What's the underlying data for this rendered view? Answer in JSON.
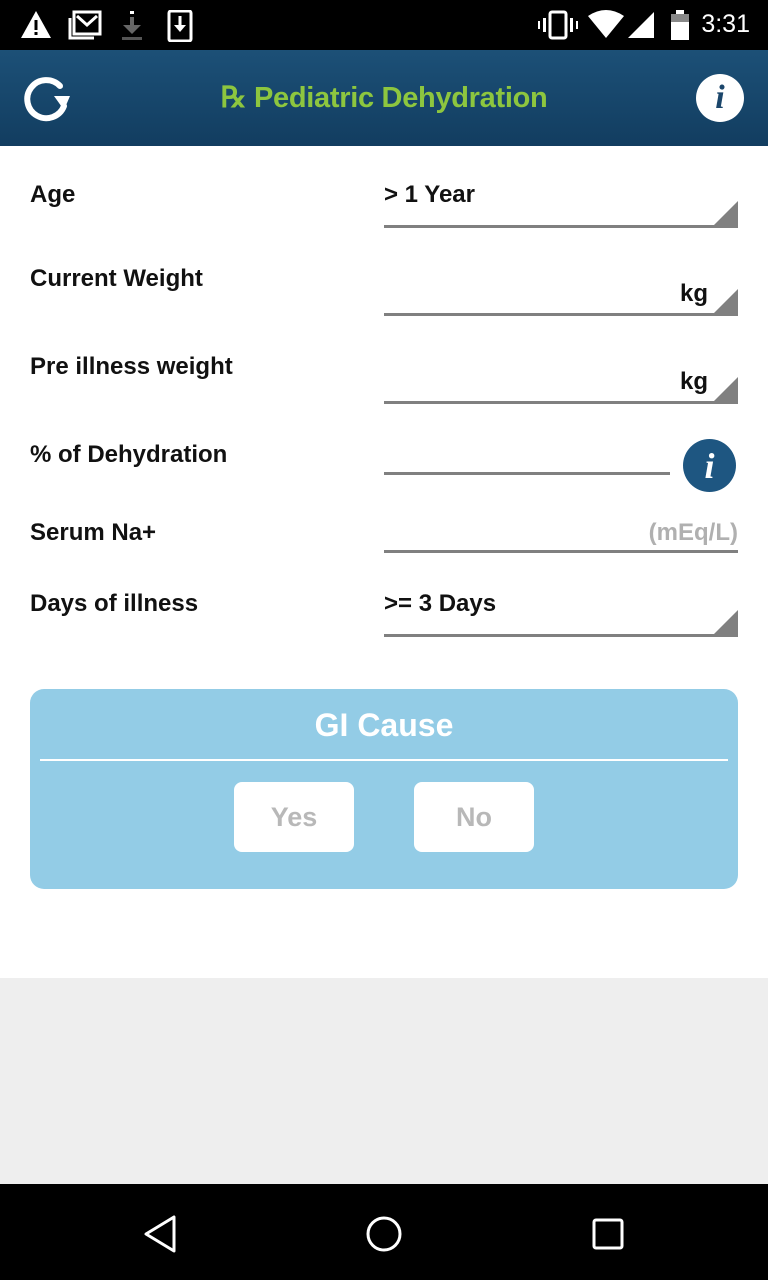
{
  "status_bar": {
    "time": "3:31",
    "left_icons": [
      "warning-icon",
      "gmail-icon",
      "download-icon",
      "download-phone-icon"
    ],
    "right_icons": [
      "vibrate-icon",
      "wifi-icon",
      "signal-icon",
      "battery-icon"
    ]
  },
  "app_bar": {
    "title": "℞ Pediatric Dehydration",
    "refresh_icon": "refresh-icon",
    "info_icon": "info-icon",
    "info_glyph": "i"
  },
  "form": {
    "age": {
      "label": "Age",
      "value": "> 1 Year"
    },
    "current_weight": {
      "label": "Current Weight",
      "value": "",
      "unit": "kg"
    },
    "pre_illness_weight": {
      "label": "Pre illness weight",
      "value": "",
      "unit": "kg"
    },
    "dehydration": {
      "label": "% of Dehydration",
      "value": "",
      "info_glyph": "i"
    },
    "serum_na": {
      "label": "Serum Na+",
      "value": "",
      "placeholder": "(mEq/L)"
    },
    "days_of_illness": {
      "label": "Days of illness",
      "value": ">= 3 Days"
    }
  },
  "gi_cause": {
    "title": "GI Cause",
    "yes_label": "Yes",
    "no_label": "No"
  },
  "nav_bar": {
    "back_icon": "back-icon",
    "home_icon": "home-icon",
    "recents_icon": "recents-icon"
  },
  "colors": {
    "app_bar": "#1c5077",
    "title_accent": "#8dc63f",
    "card": "#93cce6",
    "info_circle": "#1e5681"
  }
}
